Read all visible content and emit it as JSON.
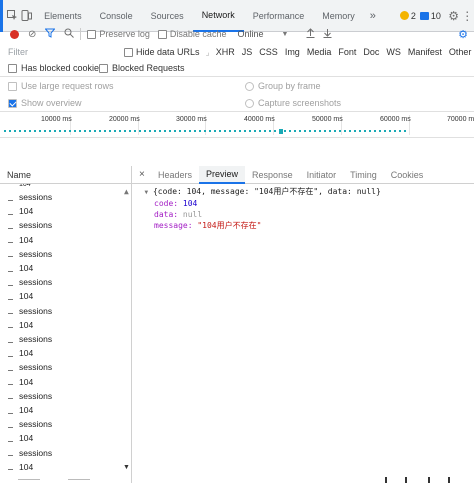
{
  "tabs": {
    "items": [
      "Elements",
      "Console",
      "Sources",
      "Network",
      "Performance",
      "Memory"
    ],
    "active_index": 3,
    "more": "»",
    "warnings_count": "2",
    "messages_count": "10"
  },
  "toolbar": {
    "preserve_log": "Preserve log",
    "disable_cache": "Disable cache",
    "throttle": "Online",
    "throttle_arrow": "▼"
  },
  "filter": {
    "placeholder": "Filter",
    "hide_data_urls": "Hide data URLs",
    "types": [
      "XHR",
      "JS",
      "CSS",
      "Img",
      "Media",
      "Font",
      "Doc",
      "WS",
      "Manifest",
      "Other"
    ]
  },
  "options": {
    "has_blocked_cookies": "Has blocked cookies",
    "blocked_requests": "Blocked Requests",
    "use_large_rows": "Use large request rows",
    "group_by_frame": "Group by frame",
    "show_overview": "Show overview",
    "capture_screenshots": "Capture screenshots"
  },
  "timeline": {
    "ticks": [
      "10000 ms",
      "20000 ms",
      "30000 ms",
      "40000 ms",
      "50000 ms",
      "60000 ms",
      "70000 ms"
    ]
  },
  "list": {
    "header": "Name",
    "partial_top": "104",
    "items": [
      "sessions",
      "104",
      "sessions",
      "104",
      "sessions",
      "104",
      "sessions",
      "104",
      "sessions",
      "104",
      "sessions",
      "104",
      "sessions",
      "104",
      "sessions",
      "104",
      "sessions",
      "104",
      "sessions",
      "104"
    ]
  },
  "detail": {
    "close": "×",
    "tabs": [
      "Headers",
      "Preview",
      "Response",
      "Initiator",
      "Timing",
      "Cookies"
    ],
    "active_index": 1
  },
  "preview": {
    "summary": "{code: 104, message: \"104用户不存在\", data: null}",
    "code_key": "code:",
    "code_value": "104",
    "data_key": "data:",
    "data_value": "null",
    "message_key": "message:",
    "message_value": "\"104用户不存在\""
  },
  "colors": {
    "accent": "#1a73e8",
    "record": "#d93025",
    "warning": "#f4b400",
    "overview_dots": "#19a9b5"
  }
}
